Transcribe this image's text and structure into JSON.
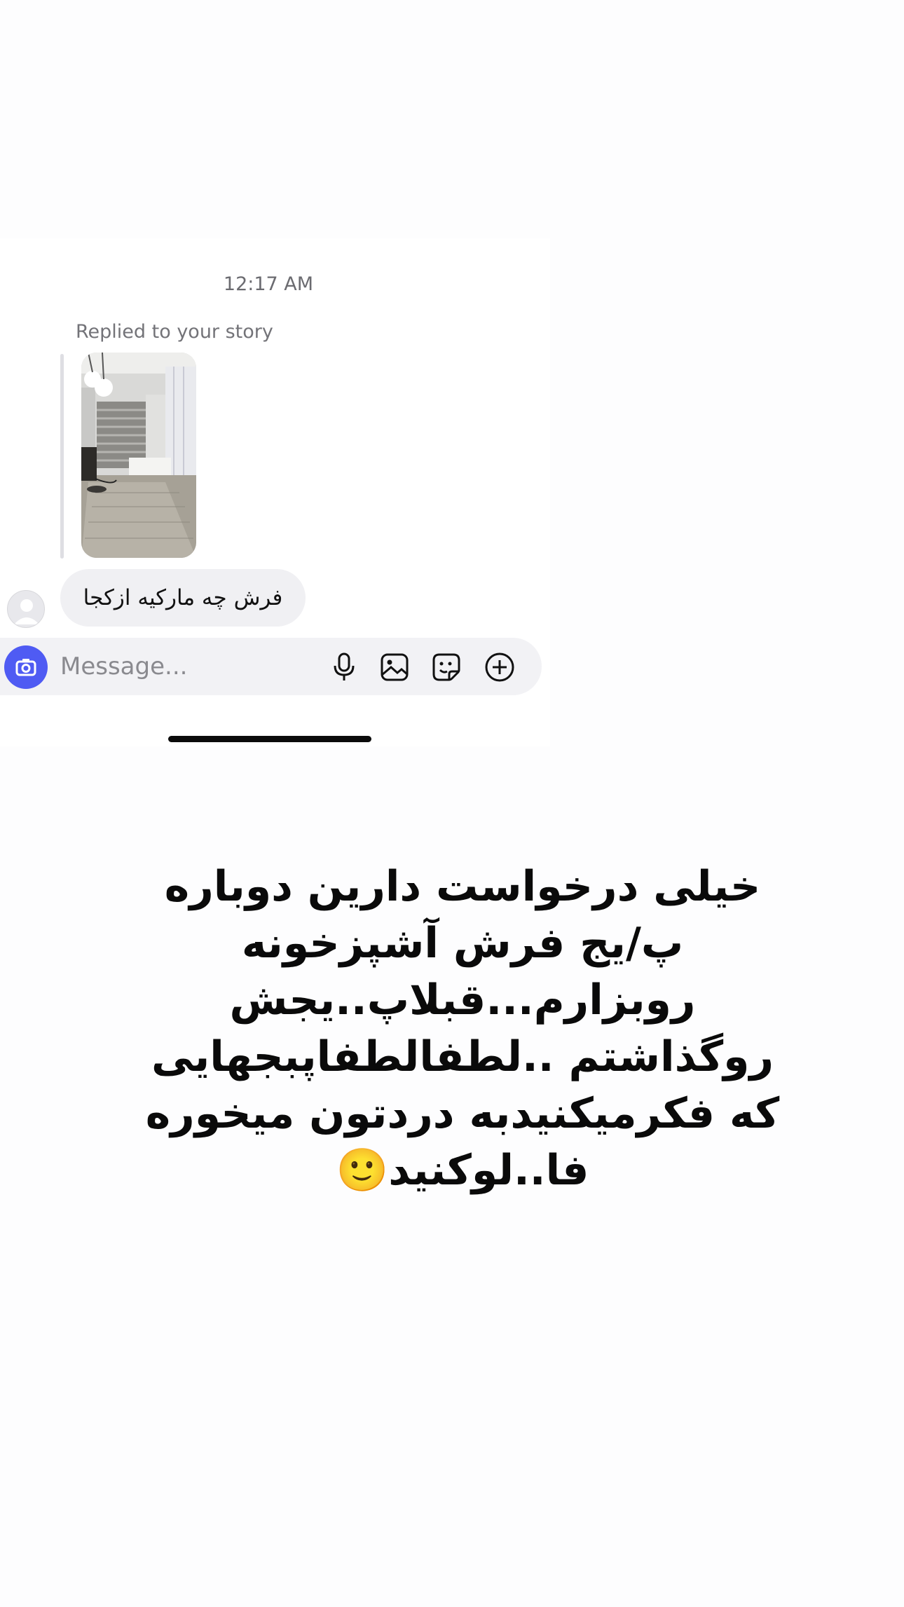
{
  "chat": {
    "timestamp": "12:17 AM",
    "replied_label": "Replied to your story",
    "message_text": "فرش چه مارکیه ازکجا"
  },
  "composer": {
    "placeholder": "Message...",
    "icons": [
      "camera-icon",
      "microphone-icon",
      "gallery-icon",
      "sticker-icon",
      "plus-icon"
    ],
    "accent_color": "#4f5bf3"
  },
  "overlay": {
    "lines": [
      "خیلی درخواست دارین دوباره",
      "پ/یج فرش آشپزخونه",
      "روبزارم...قبلاپ..یجش",
      "روگذاشتم ..لطفالطفاپبجهایی",
      "که فکرمیکنیدبه دردتون میخوره",
      "فا..لوکنید🙂"
    ]
  }
}
